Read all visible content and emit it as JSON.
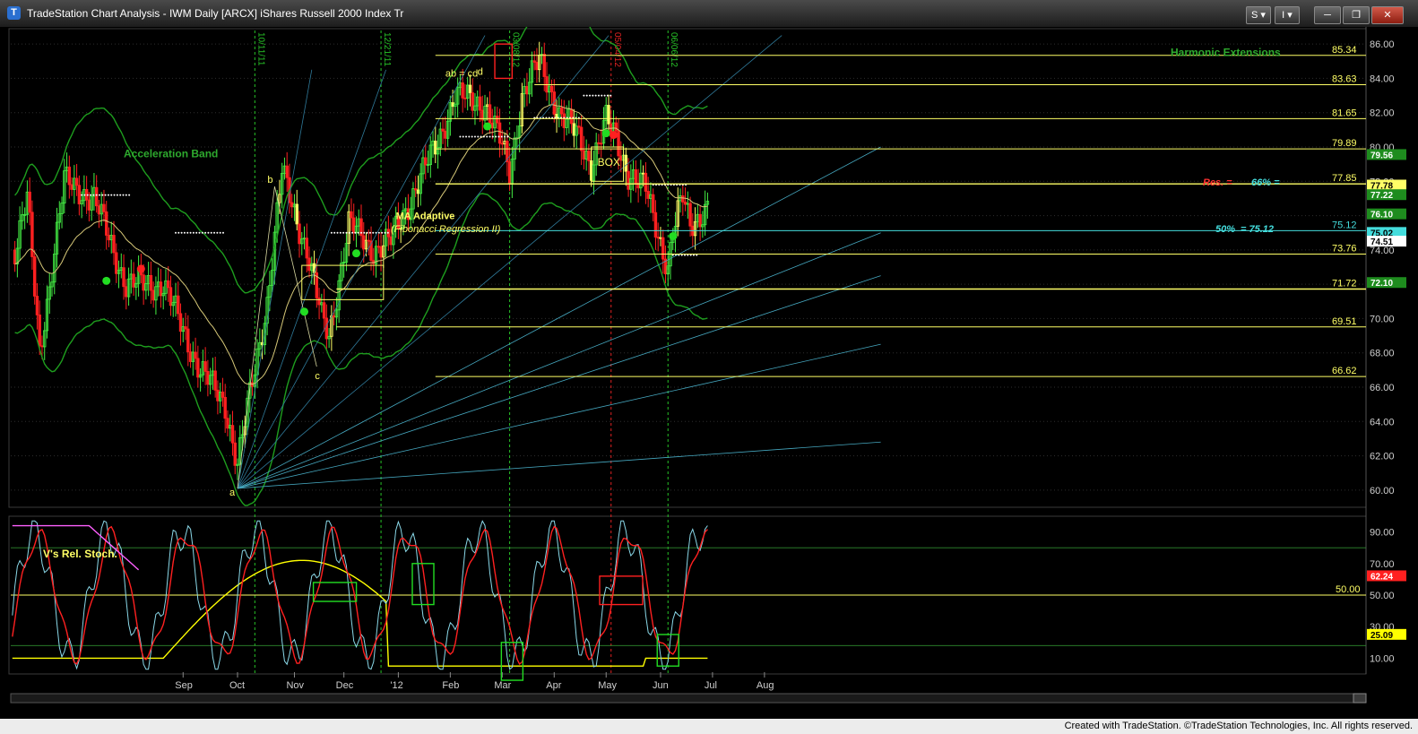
{
  "window": {
    "title": "TradeStation Chart Analysis - IWM Daily [ARCX] iShares Russell 2000 Index Tr",
    "buttons": [
      {
        "name": "symbol-link-button",
        "label": "S ▾"
      },
      {
        "name": "interval-link-button",
        "label": "I ▾"
      },
      {
        "name": "minimize-button",
        "label": "─"
      },
      {
        "name": "restore-button",
        "label": "❐"
      },
      {
        "name": "close-button",
        "label": "✕"
      }
    ]
  },
  "colors": {
    "grid": "#2e2e2e",
    "fib_line": "#ffff66",
    "cyan_line": "#44dddd",
    "band": "#1e9e1e",
    "ma": "#d6c878",
    "stoch_red": "#ff2020",
    "stoch_cyan": "#8ad8e8",
    "stoch_yellow": "#ffff00",
    "stoch_pink": "#ff60ff",
    "up_candle": "#44ee44",
    "down_candle": "#ff2020",
    "neutral_candle": "#ffff66"
  },
  "chart_data": [
    {
      "type": "candlestick",
      "symbol": "IWM",
      "interval": "Daily",
      "ylim": [
        59,
        87
      ],
      "y_ticks": [
        "86.00",
        "84.00",
        "82.00",
        "80.00",
        "78.00",
        "76.00",
        "74.00",
        "72.00",
        "70.00",
        "68.00",
        "66.00",
        "64.00",
        "62.00",
        "60.00"
      ],
      "x_ticks": [
        "Sep",
        "Oct",
        "Nov",
        "Dec",
        "'12",
        "Feb",
        "Mar",
        "Apr",
        "May",
        "Jun",
        "Jul",
        "Aug"
      ],
      "vertical_markers": [
        "10/11/11",
        "12/21/11",
        "03/08/12",
        "05/04/12",
        "06/06/12"
      ],
      "indicators": [
        "Acceleration Band",
        "MA Adaptive",
        "(Fibonacci Regression II)",
        "Harmonic Extensions"
      ],
      "pattern_labels": [
        "a",
        "b",
        "c",
        "ab = cd",
        "d",
        "BOX"
      ],
      "harmonic_levels": [
        "85.34",
        "83.63",
        "81.65",
        "79.89",
        "77.85",
        "75.12",
        "73.76",
        "71.72",
        "69.51",
        "66.62"
      ],
      "annotations": {
        "res_label": "Res. =",
        "res_value": "66% =",
        "half_label": "50%",
        "half_value": "= 75.12"
      },
      "price_tags": [
        {
          "value": "79.56",
          "color": "#1e8c1e",
          "text": "#ffffff"
        },
        {
          "value": "77.78",
          "color": "#ffff66",
          "text": "#000000"
        },
        {
          "value": "77.22",
          "color": "#1e8c1e",
          "text": "#ffffff"
        },
        {
          "value": "76.10",
          "color": "#1e8c1e",
          "text": "#ffffff"
        },
        {
          "value": "75.02",
          "color": "#44dddd",
          "text": "#000000"
        },
        {
          "value": "74.51",
          "color": "#ffffff",
          "text": "#000000"
        },
        {
          "value": "72.10",
          "color": "#1e8c1e",
          "text": "#ffffff"
        }
      ]
    },
    {
      "type": "line",
      "title": "V's Rel. Stoch.",
      "ylim": [
        0,
        100
      ],
      "y_ticks": [
        "90.00",
        "70.00",
        "50.00",
        "30.00",
        "10.00"
      ],
      "reference_level": "50.00",
      "price_tags": [
        {
          "value": "62.24",
          "color": "#ff2020",
          "text": "#ffffff"
        },
        {
          "value": "25.09",
          "color": "#ffff00",
          "text": "#000000"
        }
      ]
    }
  ],
  "footer": {
    "text": "Created with TradeStation. ©TradeStation Technologies, Inc. All rights reserved."
  }
}
